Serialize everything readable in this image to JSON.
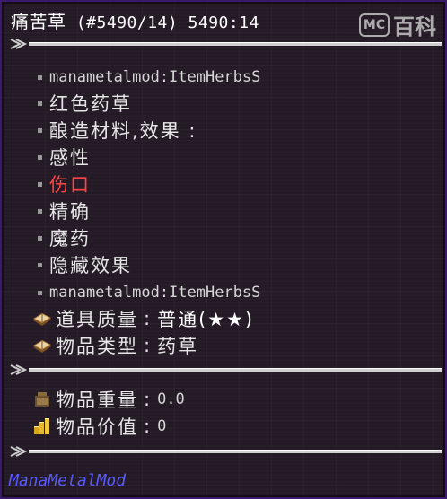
{
  "tooltip": {
    "title_name": "痛苦草",
    "title_id": "(#5490/14) 5490:14",
    "watermark": {
      "logo": "MC",
      "text": "百科"
    },
    "lines": [
      {
        "text": "manametalmod:ItemHerbsS",
        "style": "mono"
      },
      {
        "text": "红色药草",
        "style": "cn"
      },
      {
        "text": "酿造材料,效果 :",
        "style": "cn"
      },
      {
        "text": "感性",
        "style": "cn"
      },
      {
        "text": "伤口",
        "style": "cn-red"
      },
      {
        "text": "精确",
        "style": "cn"
      },
      {
        "text": "魔药",
        "style": "cn"
      },
      {
        "text": "隐藏效果",
        "style": "cn"
      },
      {
        "text": "manametalmod:ItemHerbsS",
        "style": "mono"
      }
    ],
    "properties": [
      {
        "icon": "book-icon",
        "label": "道具质量",
        "value": "普通(★★)"
      },
      {
        "icon": "book-icon",
        "label": "物品类型",
        "value": "药草"
      }
    ],
    "stats": [
      {
        "icon": "weight-icon",
        "label": "物品重量",
        "value": "0.0"
      },
      {
        "icon": "coins-icon",
        "label": "物品价值",
        "value": "0"
      }
    ],
    "footer": "ManaMetalMod",
    "colors": {
      "accent_red": "#ff4444",
      "mod_blue": "#5a5aff",
      "border": "#3a1a6a"
    }
  }
}
